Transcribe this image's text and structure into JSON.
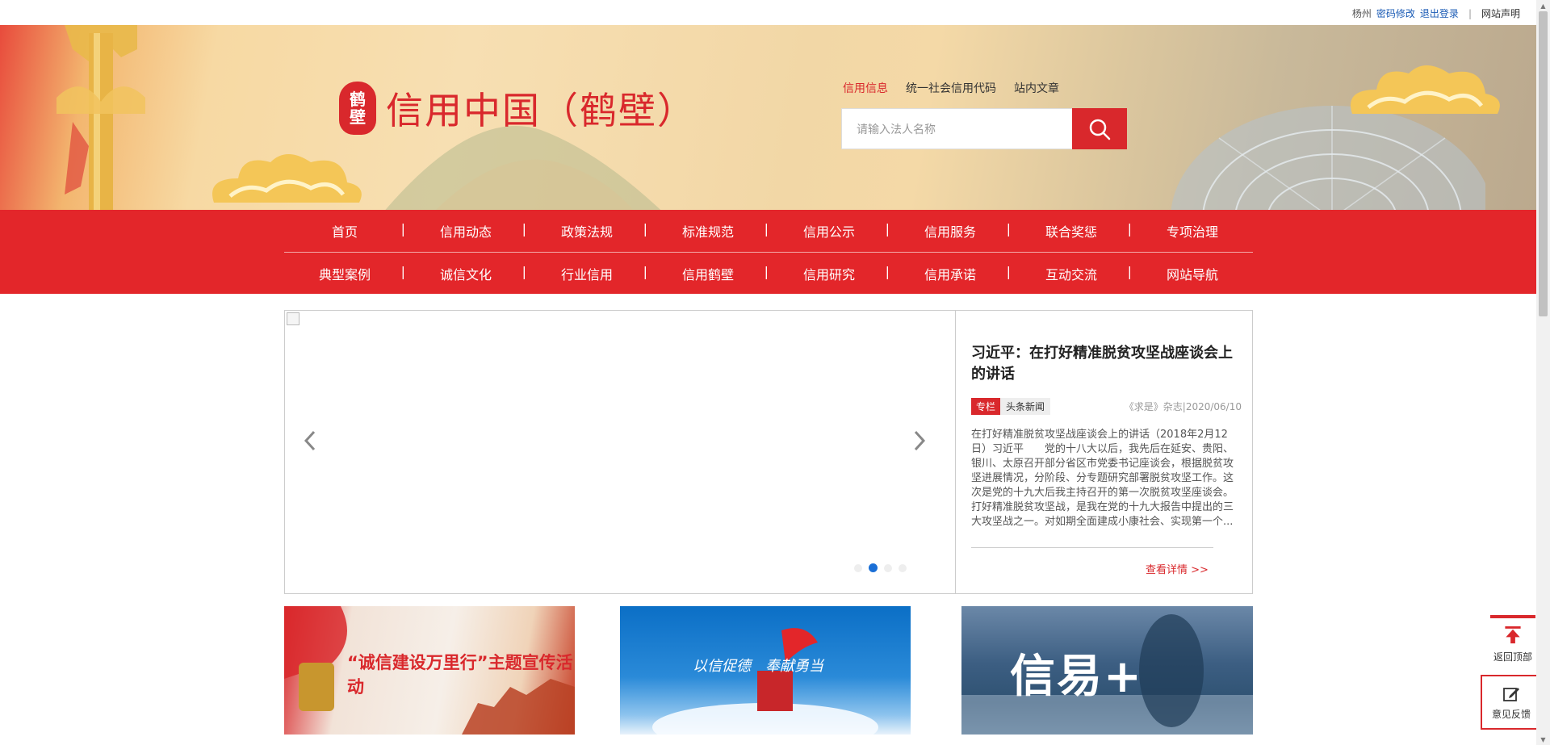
{
  "topbar": {
    "city": "杨州",
    "change_password": "密码修改",
    "logout": "退出登录",
    "separator": "|",
    "site_statement": "网站声明"
  },
  "logo": {
    "seal_chars": [
      "鹤",
      "壁"
    ],
    "title": "信用中国（鹤壁）"
  },
  "search": {
    "tabs": [
      {
        "label": "信用信息",
        "active": true
      },
      {
        "label": "统一社会信用代码",
        "active": false
      },
      {
        "label": "站内文章",
        "active": false
      }
    ],
    "placeholder": "请输入法人名称",
    "button_icon": "search-icon"
  },
  "nav": {
    "row1": [
      "首页",
      "信用动态",
      "政策法规",
      "标准规范",
      "信用公示",
      "信用服务",
      "联合奖惩",
      "专项治理"
    ],
    "row2": [
      "典型案例",
      "诚信文化",
      "行业信用",
      "信用鹤壁",
      "信用研究",
      "信用承诺",
      "互动交流",
      "网站导航"
    ]
  },
  "slider": {
    "prev_icon": "chevron-left-icon",
    "next_icon": "chevron-right-icon",
    "dot_count": 4,
    "active_dot": 1
  },
  "news": {
    "title": "习近平：在打好精准脱贫攻坚战座谈会上的讲话",
    "tag_red": "专栏",
    "tag_gray": "头条新闻",
    "source": "《求是》杂志|2020/06/10",
    "summary": "在打好精准脱贫攻坚战座谈会上的讲话（2018年2月12日）习近平　　党的十八大以后，我先后在延安、贵阳、银川、太原召开部分省区市党委书记座谈会，根据脱贫攻坚进展情况，分阶段、分专题研究部署脱贫攻坚工作。这次是党的十九大后我主持召开的第一次脱贫攻坚座谈会。　　打好精准脱贫攻坚战，是我在党的十九大报告中提出的三大攻坚战之一。对如期全面建成小康社会、实现第一个...",
    "more": "查看详情 >>"
  },
  "banners": {
    "b1_text": "“诚信建设万里行”主题宣传活动",
    "b2_text": "以信促德　奉献勇当",
    "b3_text": "信易+"
  },
  "float": {
    "back_to_top": "返回顶部",
    "feedback": "意见反馈"
  },
  "colors": {
    "brand_red": "#d9282c",
    "nav_red": "#e3262a",
    "link_blue": "#1a5bb5",
    "dot_active": "#1a6fd6"
  }
}
